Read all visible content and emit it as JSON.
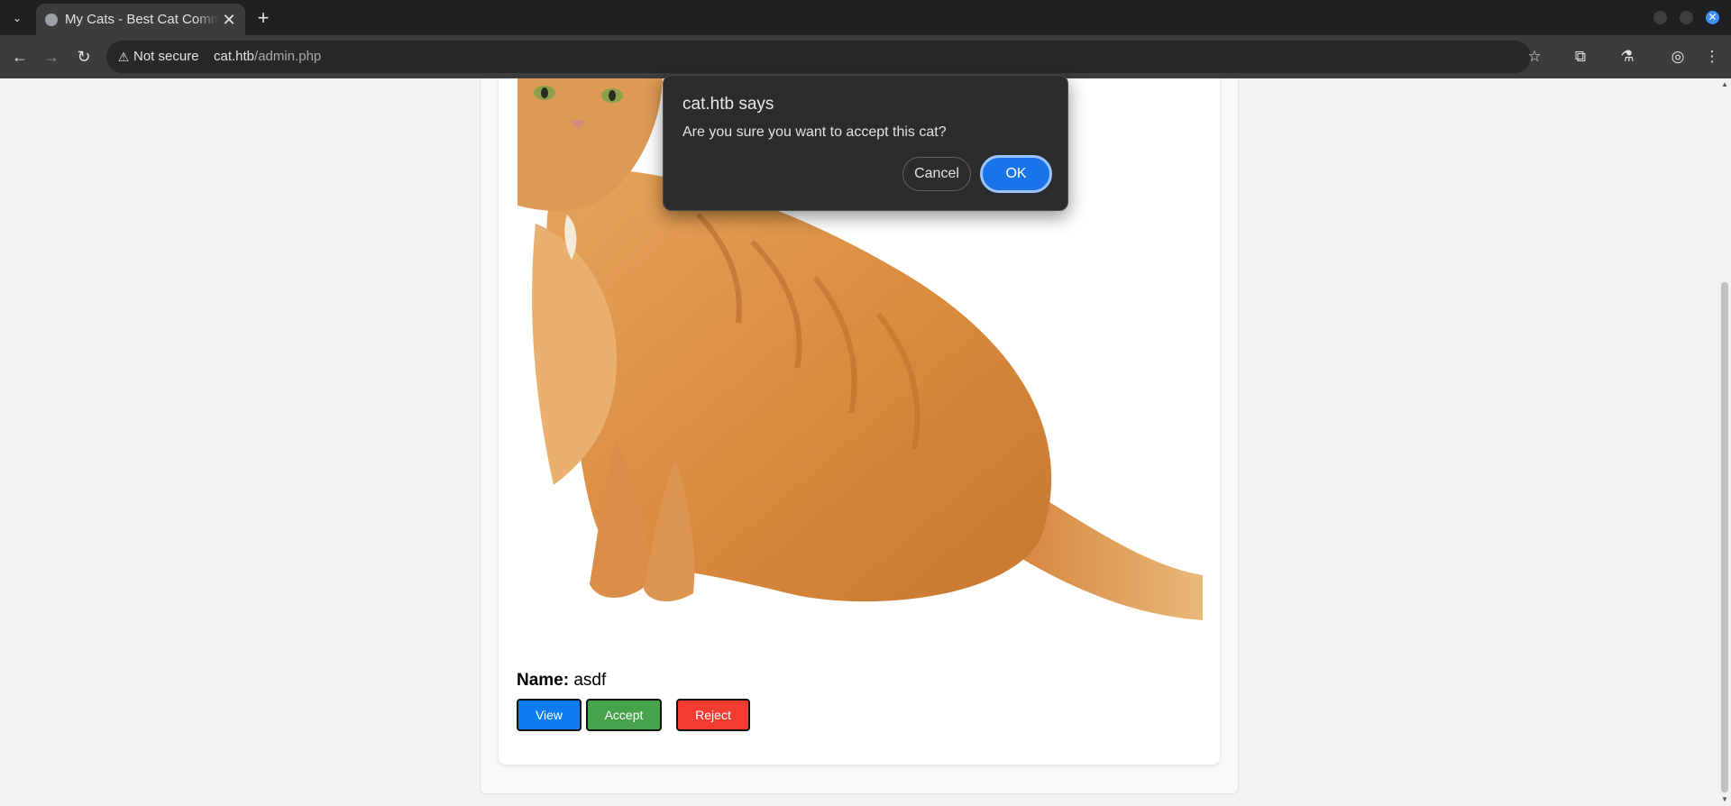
{
  "browser": {
    "tab": {
      "title": "My Cats - Best Cat Community",
      "favicon": "globe-icon"
    },
    "newtab_symbol": "+",
    "address": {
      "security_label": "Not secure",
      "host": "cat.htb",
      "path": "/admin.php"
    }
  },
  "page": {
    "cat_card": {
      "name_label": "Name:",
      "name_value": "asdf",
      "buttons": {
        "view": "View",
        "accept": "Accept",
        "reject": "Reject"
      },
      "colors": {
        "view": "#0d7bf2",
        "accept": "#47a34b",
        "reject": "#f23c32"
      }
    }
  },
  "dialog": {
    "title": "cat.htb says",
    "message": "Are you sure you want to accept this cat?",
    "cancel_label": "Cancel",
    "ok_label": "OK",
    "accent": "#1a73e8"
  }
}
